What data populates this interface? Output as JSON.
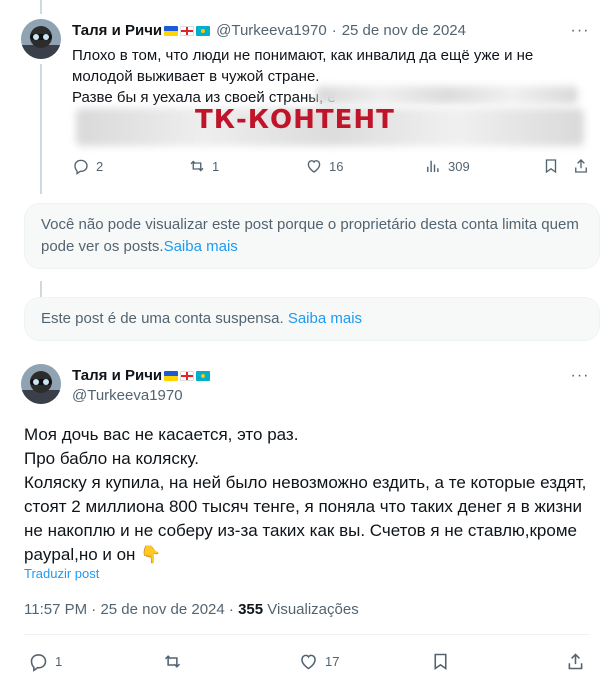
{
  "reply_tweet": {
    "display_name": "Таля и Ричи",
    "handle": "@Turkeeva1970",
    "date": "25 de nov de 2024",
    "text_line1": "Плохо в том, что люди не понимают, как инвалид да ещё уже и не",
    "text_line2": "молодой выживает в чужой стране.",
    "text_line3": "Разве бы я уехала из своей страны, е",
    "watermark": "ТК-КОНТЕНТ",
    "replies": "2",
    "reposts": "1",
    "likes": "16",
    "views": "309"
  },
  "notice_restricted": {
    "text": "Você não pode visualizar este post porque o proprietário desta conta limita quem pode ver os posts.",
    "link": "Saiba mais"
  },
  "notice_suspended": {
    "text": "Este post é de uma conta suspensa.",
    "link": "Saiba mais"
  },
  "main_tweet": {
    "display_name": "Таля и Ричи",
    "handle": "@Turkeeva1970",
    "lines": [
      "Моя дочь вас не касается, это раз.",
      "Про бабло на коляску.",
      "Коляску я купила, на ней было невозможно ездить, а те которые ездят,",
      "стоят 2 миллиона 800 тысяч тенге, я поняла что таких денег я в жизни",
      "не накоплю и не соберу из-за таких как вы. Счетов я не ставлю,кроме",
      "paypal,но и он"
    ],
    "emoji": "👇",
    "translate_link": "Traduzir post",
    "time": "11:57 PM",
    "date": "25 de nov de 2024",
    "views_count": "355",
    "views_label": "Visualizações",
    "replies": "1",
    "likes": "17"
  },
  "colors": {
    "accent": "#1d9bf0",
    "muted": "#536471",
    "watermark": "#c0142a"
  }
}
